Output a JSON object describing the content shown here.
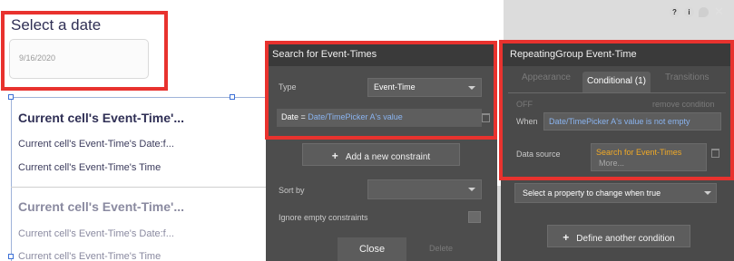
{
  "canvas": {
    "date_title": "Select a date",
    "date_value": "9/16/2020",
    "cells": [
      {
        "header": "Current cell's Event-Time'...",
        "line1": "Current cell's Event-Time's Date:f...",
        "line2": "Current cell's Event-Time's Time"
      },
      {
        "header": "Current cell's Event-Time'...",
        "line1": "Current cell's Event-Time's Date:f...",
        "line2": "Current cell's Event-Time's Time"
      }
    ]
  },
  "search_panel": {
    "title": "Search for Event-Times",
    "type_label": "Type",
    "type_value": "Event-Time",
    "constraint_field": "Date =",
    "constraint_value": "Date/TimePicker A's value",
    "add_constraint": "Add a new constraint",
    "sort_by_label": "Sort by",
    "ignore_empty_label": "Ignore empty constraints",
    "close_label": "Close",
    "delete_label": "Delete"
  },
  "property_panel": {
    "title": "RepeatingGroup Event-Time",
    "tabs": [
      "Appearance",
      "Conditional (1)",
      "Transitions"
    ],
    "off_label": "OFF",
    "remove_condition": "remove condition",
    "when_label": "When",
    "when_value": "Date/TimePicker A's value is not empty",
    "data_source_label": "Data source",
    "data_source_value": "Search for Event-Times",
    "data_source_more": "More...",
    "property_select_placeholder": "Select a property to change when true",
    "define_condition": "Define another condition"
  },
  "colors": {
    "highlight": "#e8322e",
    "dynamic_value": "#8ab4f0",
    "data_source": "#f0a926",
    "panel_dark": "#4d4d4d"
  }
}
